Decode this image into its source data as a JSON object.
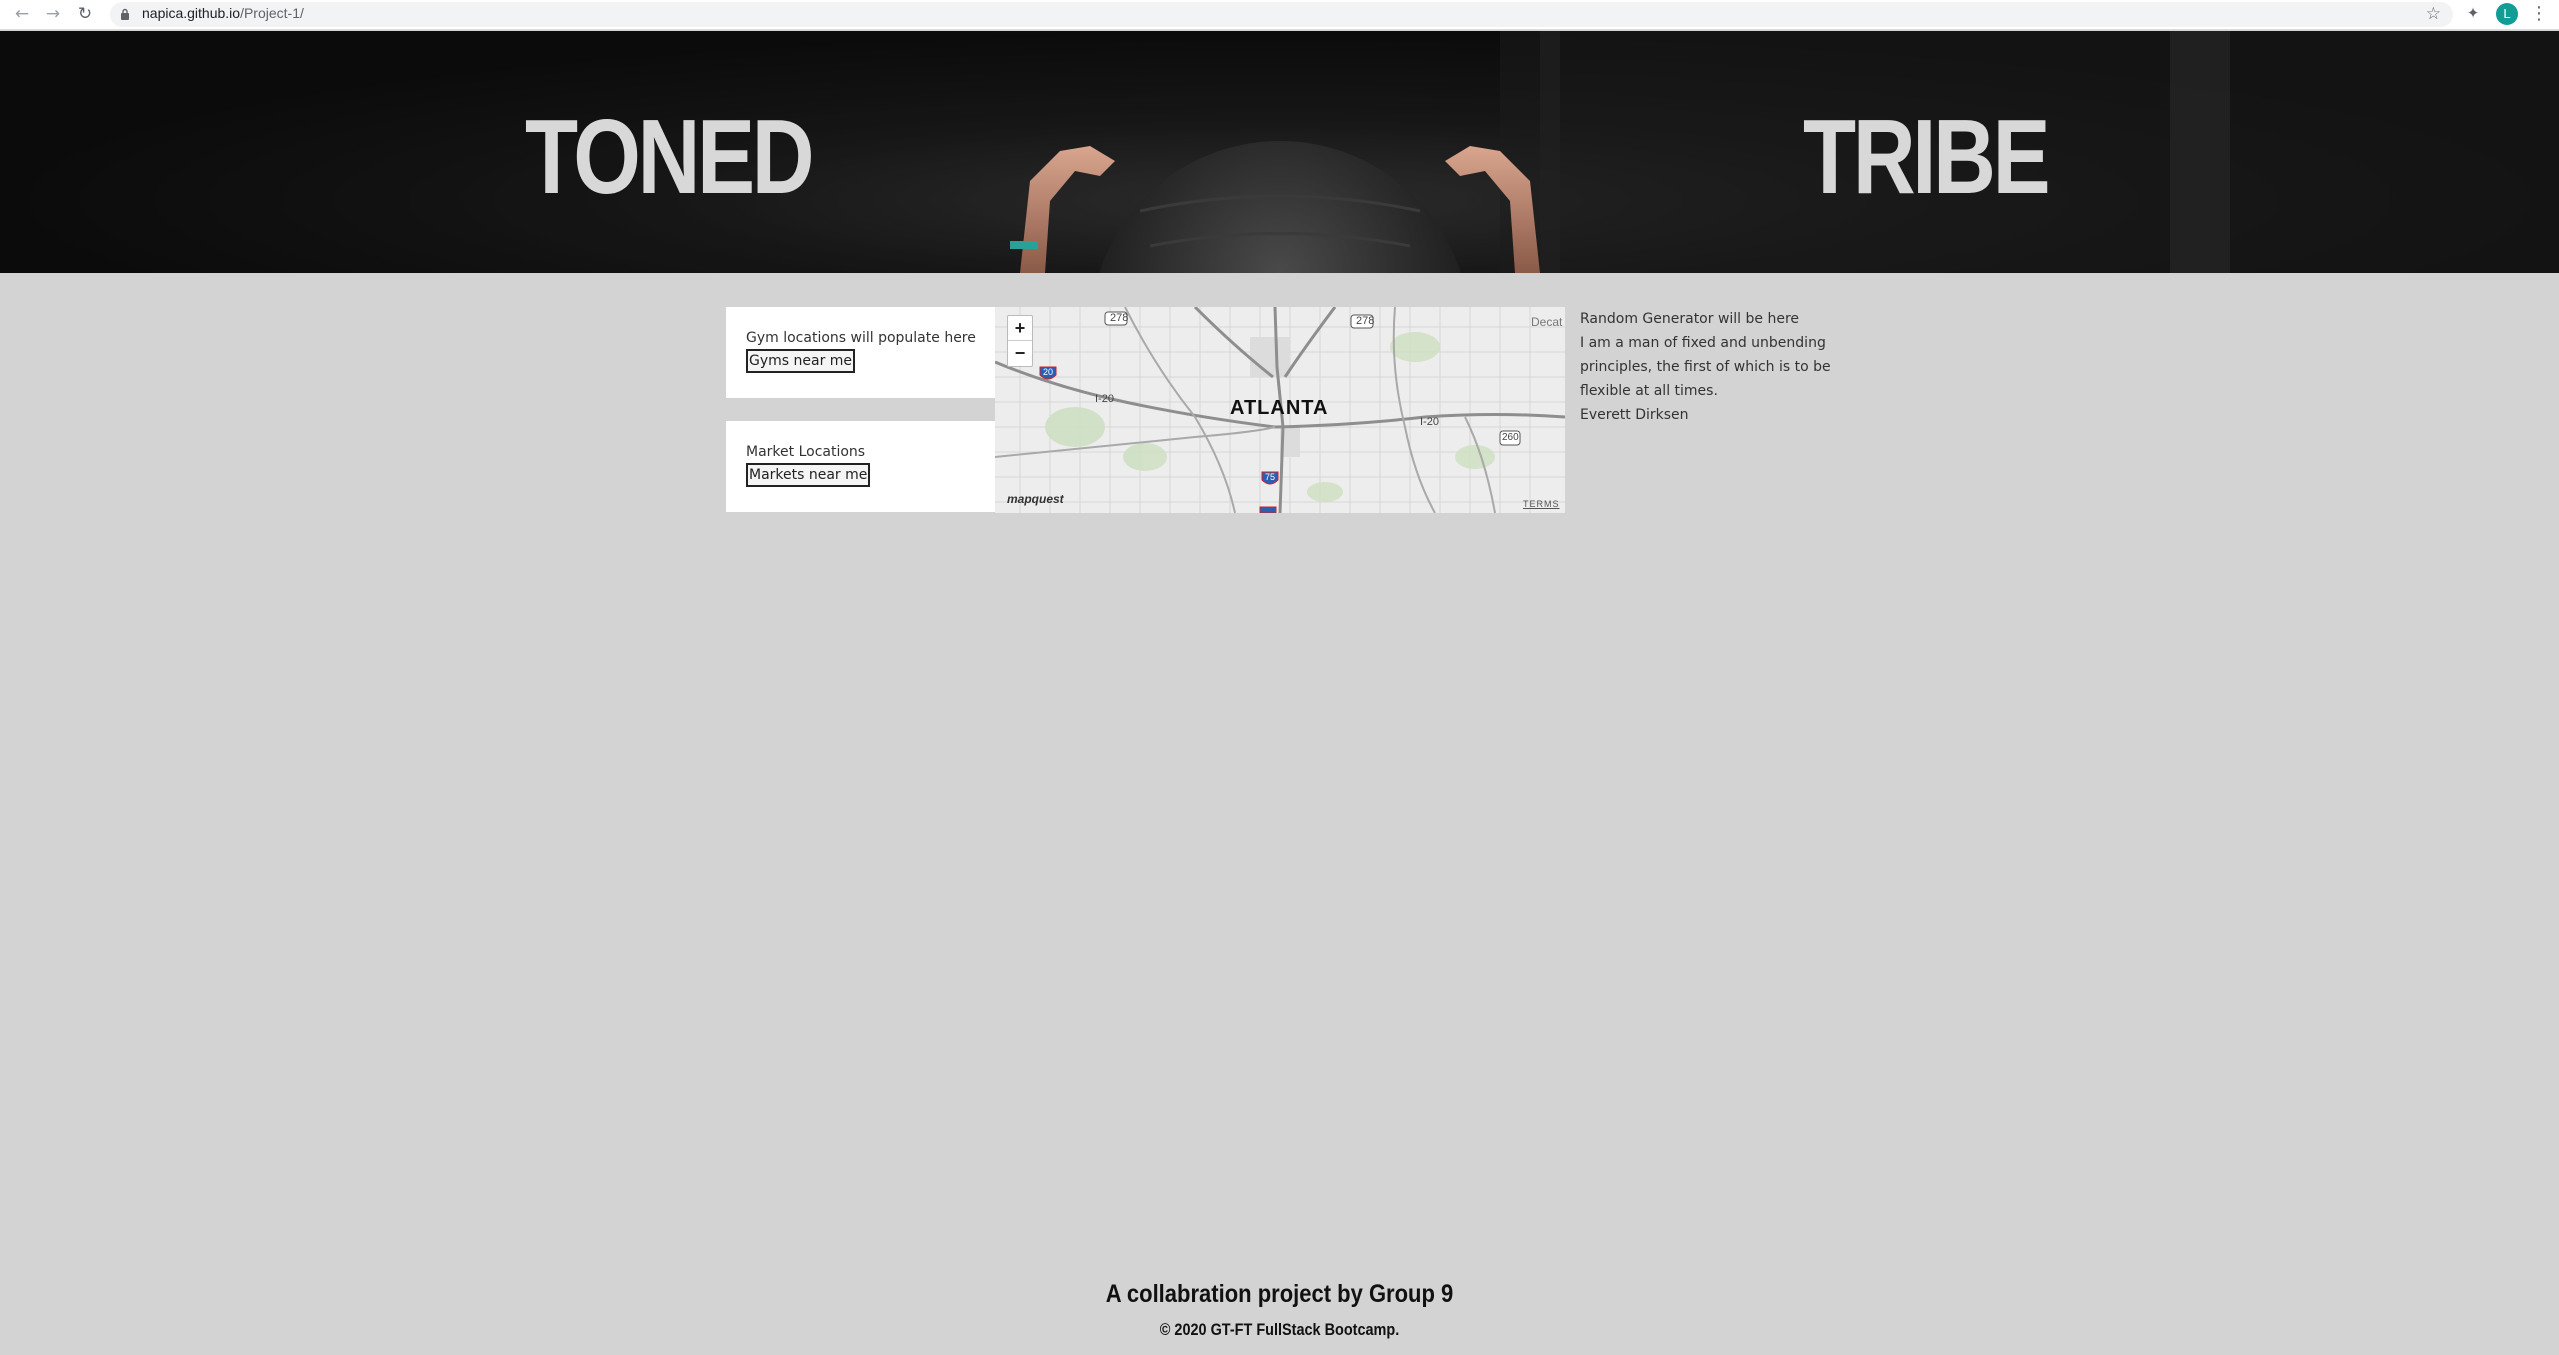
{
  "browser": {
    "url_host": "napica.github.io",
    "url_path": "/Project-1/",
    "profile_initial": "L"
  },
  "hero": {
    "title_left": "TONED",
    "title_right": "TRIBE"
  },
  "gym_card": {
    "text": "Gym locations will populate here",
    "button_label": "Gyms near me"
  },
  "market_card": {
    "text": "Market Locations",
    "button_label": "Markets near me"
  },
  "map": {
    "zoom_in": "+",
    "zoom_out": "−",
    "city": "ATLANTA",
    "roads": {
      "i20_west": "I-20",
      "i20_east": "I-20",
      "us278_west": "278",
      "us278_east": "278",
      "i20_shield": "20",
      "i75_shield": "75",
      "route_260": "260"
    },
    "decatur_partial": "Decat",
    "provider": "mapquest",
    "terms": "TERMS"
  },
  "quote": {
    "heading": "Random Generator will be here",
    "text": "I am a man of fixed and unbending principles, the first of which is to be flexible at all times.",
    "author": "Everett Dirksen"
  },
  "footer": {
    "title": "A collabration project by Group 9",
    "copyright": "© 2020 GT-FT FullStack Bootcamp."
  }
}
